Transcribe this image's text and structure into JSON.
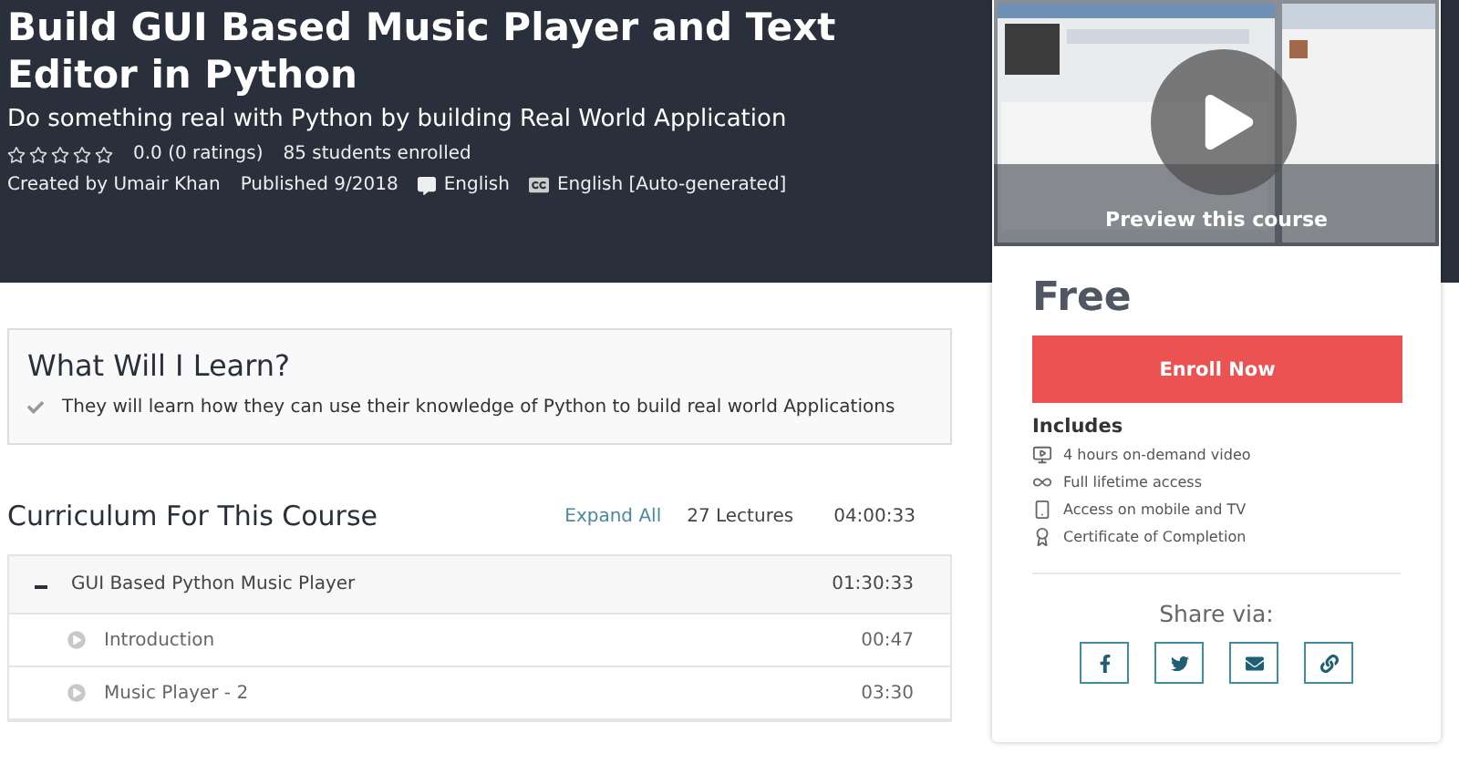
{
  "course": {
    "title": "Build GUI Based Music Player and Text Editor in Python",
    "subtitle": "Do something real with Python by building Real World Application",
    "stars": 0,
    "rating": "0.0 (0 ratings)",
    "enrolled": "85 students enrolled",
    "author": "Created by Umair Khan",
    "published": "Published 9/2018",
    "language": "English",
    "captions": "English [Auto-generated]"
  },
  "preview": {
    "kind": "picture",
    "caption": "Preview this course"
  },
  "purchase": {
    "price": "Free",
    "button": "Enroll Now",
    "includes_title": "Includes",
    "includes": [
      {
        "kind": "video",
        "text": "4 hours on-demand video"
      },
      {
        "kind": "lifetime",
        "text": "Full lifetime access"
      },
      {
        "kind": "mobile",
        "text": "Access on mobile and TV"
      },
      {
        "kind": "certificate",
        "text": "Certificate of Completion"
      }
    ],
    "share_title": "Share via:",
    "share": [
      {
        "kind": "facebook"
      },
      {
        "kind": "twitter"
      },
      {
        "kind": "email"
      },
      {
        "kind": "link"
      }
    ]
  },
  "learn": {
    "title": "What Will I Learn?",
    "items": [
      "They will learn how they can use their knowledge of Python to build real world Applications"
    ]
  },
  "curriculum": {
    "title": "Curriculum For This Course",
    "expand": "Expand All",
    "lectures": "27 Lectures",
    "duration": "04:00:33",
    "sections": [
      {
        "title": "GUI Based Python Music Player",
        "duration": "01:30:33",
        "expanded": true,
        "children": [
          {
            "title": "Introduction",
            "duration": "00:47"
          },
          {
            "title": "Music Player - 2",
            "duration": "03:30"
          }
        ]
      }
    ]
  }
}
